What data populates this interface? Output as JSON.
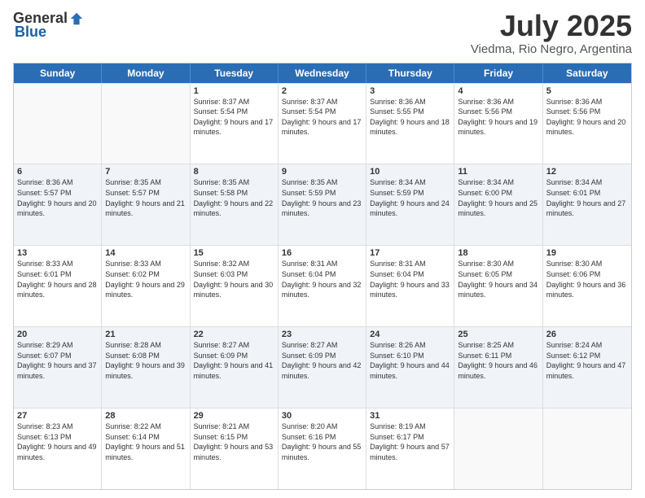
{
  "logo": {
    "general": "General",
    "blue": "Blue"
  },
  "title": "July 2025",
  "location": "Viedma, Rio Negro, Argentina",
  "headers": [
    "Sunday",
    "Monday",
    "Tuesday",
    "Wednesday",
    "Thursday",
    "Friday",
    "Saturday"
  ],
  "weeks": [
    [
      {
        "day": "",
        "sunrise": "",
        "sunset": "",
        "daylight": "",
        "empty": true
      },
      {
        "day": "",
        "sunrise": "",
        "sunset": "",
        "daylight": "",
        "empty": true
      },
      {
        "day": "1",
        "sunrise": "Sunrise: 8:37 AM",
        "sunset": "Sunset: 5:54 PM",
        "daylight": "Daylight: 9 hours and 17 minutes."
      },
      {
        "day": "2",
        "sunrise": "Sunrise: 8:37 AM",
        "sunset": "Sunset: 5:54 PM",
        "daylight": "Daylight: 9 hours and 17 minutes."
      },
      {
        "day": "3",
        "sunrise": "Sunrise: 8:36 AM",
        "sunset": "Sunset: 5:55 PM",
        "daylight": "Daylight: 9 hours and 18 minutes."
      },
      {
        "day": "4",
        "sunrise": "Sunrise: 8:36 AM",
        "sunset": "Sunset: 5:56 PM",
        "daylight": "Daylight: 9 hours and 19 minutes."
      },
      {
        "day": "5",
        "sunrise": "Sunrise: 8:36 AM",
        "sunset": "Sunset: 5:56 PM",
        "daylight": "Daylight: 9 hours and 20 minutes."
      }
    ],
    [
      {
        "day": "6",
        "sunrise": "Sunrise: 8:36 AM",
        "sunset": "Sunset: 5:57 PM",
        "daylight": "Daylight: 9 hours and 20 minutes."
      },
      {
        "day": "7",
        "sunrise": "Sunrise: 8:35 AM",
        "sunset": "Sunset: 5:57 PM",
        "daylight": "Daylight: 9 hours and 21 minutes."
      },
      {
        "day": "8",
        "sunrise": "Sunrise: 8:35 AM",
        "sunset": "Sunset: 5:58 PM",
        "daylight": "Daylight: 9 hours and 22 minutes."
      },
      {
        "day": "9",
        "sunrise": "Sunrise: 8:35 AM",
        "sunset": "Sunset: 5:59 PM",
        "daylight": "Daylight: 9 hours and 23 minutes."
      },
      {
        "day": "10",
        "sunrise": "Sunrise: 8:34 AM",
        "sunset": "Sunset: 5:59 PM",
        "daylight": "Daylight: 9 hours and 24 minutes."
      },
      {
        "day": "11",
        "sunrise": "Sunrise: 8:34 AM",
        "sunset": "Sunset: 6:00 PM",
        "daylight": "Daylight: 9 hours and 25 minutes."
      },
      {
        "day": "12",
        "sunrise": "Sunrise: 8:34 AM",
        "sunset": "Sunset: 6:01 PM",
        "daylight": "Daylight: 9 hours and 27 minutes."
      }
    ],
    [
      {
        "day": "13",
        "sunrise": "Sunrise: 8:33 AM",
        "sunset": "Sunset: 6:01 PM",
        "daylight": "Daylight: 9 hours and 28 minutes."
      },
      {
        "day": "14",
        "sunrise": "Sunrise: 8:33 AM",
        "sunset": "Sunset: 6:02 PM",
        "daylight": "Daylight: 9 hours and 29 minutes."
      },
      {
        "day": "15",
        "sunrise": "Sunrise: 8:32 AM",
        "sunset": "Sunset: 6:03 PM",
        "daylight": "Daylight: 9 hours and 30 minutes."
      },
      {
        "day": "16",
        "sunrise": "Sunrise: 8:31 AM",
        "sunset": "Sunset: 6:04 PM",
        "daylight": "Daylight: 9 hours and 32 minutes."
      },
      {
        "day": "17",
        "sunrise": "Sunrise: 8:31 AM",
        "sunset": "Sunset: 6:04 PM",
        "daylight": "Daylight: 9 hours and 33 minutes."
      },
      {
        "day": "18",
        "sunrise": "Sunrise: 8:30 AM",
        "sunset": "Sunset: 6:05 PM",
        "daylight": "Daylight: 9 hours and 34 minutes."
      },
      {
        "day": "19",
        "sunrise": "Sunrise: 8:30 AM",
        "sunset": "Sunset: 6:06 PM",
        "daylight": "Daylight: 9 hours and 36 minutes."
      }
    ],
    [
      {
        "day": "20",
        "sunrise": "Sunrise: 8:29 AM",
        "sunset": "Sunset: 6:07 PM",
        "daylight": "Daylight: 9 hours and 37 minutes."
      },
      {
        "day": "21",
        "sunrise": "Sunrise: 8:28 AM",
        "sunset": "Sunset: 6:08 PM",
        "daylight": "Daylight: 9 hours and 39 minutes."
      },
      {
        "day": "22",
        "sunrise": "Sunrise: 8:27 AM",
        "sunset": "Sunset: 6:09 PM",
        "daylight": "Daylight: 9 hours and 41 minutes."
      },
      {
        "day": "23",
        "sunrise": "Sunrise: 8:27 AM",
        "sunset": "Sunset: 6:09 PM",
        "daylight": "Daylight: 9 hours and 42 minutes."
      },
      {
        "day": "24",
        "sunrise": "Sunrise: 8:26 AM",
        "sunset": "Sunset: 6:10 PM",
        "daylight": "Daylight: 9 hours and 44 minutes."
      },
      {
        "day": "25",
        "sunrise": "Sunrise: 8:25 AM",
        "sunset": "Sunset: 6:11 PM",
        "daylight": "Daylight: 9 hours and 46 minutes."
      },
      {
        "day": "26",
        "sunrise": "Sunrise: 8:24 AM",
        "sunset": "Sunset: 6:12 PM",
        "daylight": "Daylight: 9 hours and 47 minutes."
      }
    ],
    [
      {
        "day": "27",
        "sunrise": "Sunrise: 8:23 AM",
        "sunset": "Sunset: 6:13 PM",
        "daylight": "Daylight: 9 hours and 49 minutes."
      },
      {
        "day": "28",
        "sunrise": "Sunrise: 8:22 AM",
        "sunset": "Sunset: 6:14 PM",
        "daylight": "Daylight: 9 hours and 51 minutes."
      },
      {
        "day": "29",
        "sunrise": "Sunrise: 8:21 AM",
        "sunset": "Sunset: 6:15 PM",
        "daylight": "Daylight: 9 hours and 53 minutes."
      },
      {
        "day": "30",
        "sunrise": "Sunrise: 8:20 AM",
        "sunset": "Sunset: 6:16 PM",
        "daylight": "Daylight: 9 hours and 55 minutes."
      },
      {
        "day": "31",
        "sunrise": "Sunrise: 8:19 AM",
        "sunset": "Sunset: 6:17 PM",
        "daylight": "Daylight: 9 hours and 57 minutes."
      },
      {
        "day": "",
        "sunrise": "",
        "sunset": "",
        "daylight": "",
        "empty": true
      },
      {
        "day": "",
        "sunrise": "",
        "sunset": "",
        "daylight": "",
        "empty": true
      }
    ]
  ]
}
